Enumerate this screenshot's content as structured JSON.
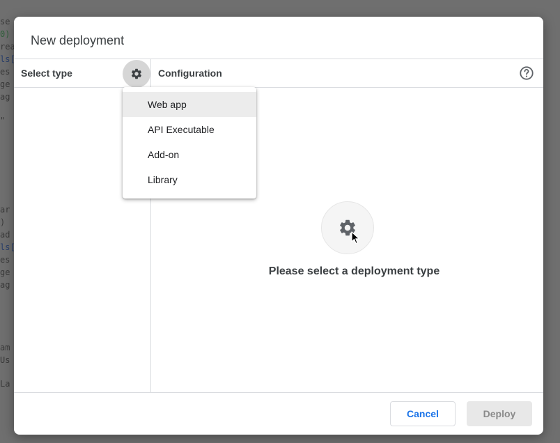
{
  "dialog": {
    "title": "New deployment",
    "select_type_label": "Select type",
    "configuration_label": "Configuration",
    "empty_state_text": "Please select a deployment type",
    "cancel_label": "Cancel",
    "deploy_label": "Deploy"
  },
  "menu": {
    "items": [
      {
        "label": "Web app",
        "highlighted": true
      },
      {
        "label": "API Executable",
        "highlighted": false
      },
      {
        "label": "Add-on",
        "highlighted": false
      },
      {
        "label": "Library",
        "highlighted": false
      }
    ]
  },
  "background_code": [
    {
      "text": "se",
      "cls": ""
    },
    {
      "text": "0)",
      "cls": "g"
    },
    {
      "text": "rea",
      "cls": ""
    },
    {
      "text": "ls[",
      "cls": "b"
    },
    {
      "text": "es",
      "cls": ""
    },
    {
      "text": "ge",
      "cls": ""
    },
    {
      "text": "ag",
      "cls": ""
    },
    {
      "text": "\"",
      "cls": ""
    },
    {
      "text": "ar",
      "cls": ""
    },
    {
      "text": ")",
      "cls": ""
    },
    {
      "text": "ad",
      "cls": ""
    },
    {
      "text": "ls[",
      "cls": "b"
    },
    {
      "text": "es",
      "cls": ""
    },
    {
      "text": "ge",
      "cls": ""
    },
    {
      "text": "ag",
      "cls": ""
    },
    {
      "text": "am",
      "cls": ""
    },
    {
      "text": "Us",
      "cls": ""
    },
    {
      "text": "La",
      "cls": ""
    }
  ],
  "icons": {
    "gear": "gear-icon",
    "help": "help-icon",
    "cursor": "mouse-pointer-icon"
  },
  "colors": {
    "accent": "#1a73e8",
    "menu_highlight": "#ececec",
    "disabled_button_bg": "#e8e8e8"
  }
}
